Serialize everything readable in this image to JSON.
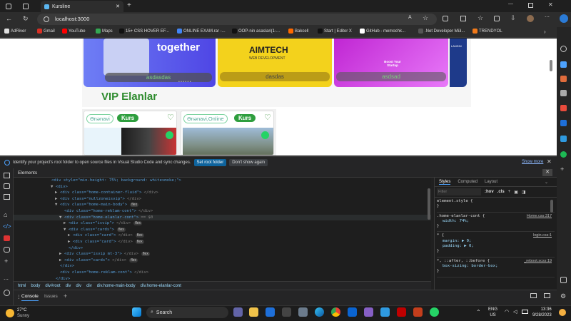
{
  "browser": {
    "tab_title": "Kursline",
    "url": "localhost:3000",
    "favorites": [
      {
        "label": "AdRiver",
        "color": "#e0e0e0"
      },
      {
        "label": "Gmail",
        "color": "#d93025"
      },
      {
        "label": "YouTube",
        "color": "#ff0000"
      },
      {
        "label": "Maps",
        "color": "#34a853"
      },
      {
        "label": "15+ CSS HOVER EF...",
        "color": "#111111"
      },
      {
        "label": "ONLINE EXAM.rar -...",
        "color": "#4285f4"
      },
      {
        "label": "OOP-nin asaslari(1-...",
        "color": "#111111"
      },
      {
        "label": "Bakcell",
        "color": "#ff6a00"
      },
      {
        "label": "Start | Editor X",
        "color": "#111111"
      },
      {
        "label": "GitHub - memochk...",
        "color": "#ffffff"
      },
      {
        "label": ".Net Developer Mül...",
        "color": "#555555"
      },
      {
        "label": "TRENDYOL",
        "color": "#f27a1a"
      }
    ]
  },
  "page": {
    "banners": [
      {
        "tag": "together",
        "caption": "asdasdas"
      },
      {
        "tag": "AIMTECH",
        "sub": "WEB DEVELOPMENT",
        "caption": "dasdas"
      },
      {
        "tag": "Boost Your Startup",
        "caption": "asdsad"
      },
      {
        "tag": "LANDIN",
        "caption": ""
      }
    ],
    "section_title": "VIP Elanlar",
    "cards": [
      {
        "name": "Ənənavi",
        "badge": "Kurs"
      },
      {
        "name": "Ənənavi,Online",
        "badge": "Kurs"
      }
    ]
  },
  "infobar": {
    "message": "Identify your project's root folder to open source files in Visual Studio Code and sync changes.",
    "primary": "Set root folder",
    "secondary": "Don't show again",
    "more": "Show more"
  },
  "devtools": {
    "panel": "Elements",
    "nodes": [
      {
        "t": "<div style=\"min-height: 75%; background: whitesmoke;\">"
      },
      {
        "t": "<div>"
      },
      {
        "t": "<div class=\"home-container-fluid\">",
        "c": "</div>"
      },
      {
        "t": "<div class=\"nullzoneisvip\">",
        "c": "</div>"
      },
      {
        "t": "<div class=\"home-main-body\">",
        "b": "flex"
      },
      {
        "t": "<div class=\"home-reklam-cont\">",
        "c": "</div>"
      },
      {
        "t": "<div class=\"home-elanlar-cont\">",
        "c": "== $0"
      },
      {
        "t": "<div class=\"isvip\">",
        "c": "</div>",
        "b": "flex"
      },
      {
        "t": "<div class=\"cards\">",
        "b": "flex"
      },
      {
        "t": "<div class=\"card\">",
        "c": "</div>",
        "b": "flex"
      },
      {
        "t": "<div class=\"card\">",
        "c": "</div>",
        "b": "flex"
      },
      {
        "t": "</div>"
      },
      {
        "t": "<div class=\"isvip mt-3\">",
        "c": "</div>",
        "b": "flex"
      },
      {
        "t": "<div class=\"cards\">",
        "c": "</div>",
        "b": "flex"
      },
      {
        "t": "</div>"
      },
      {
        "t": "<div class=\"home-reklam-cont\">",
        "c": "</div>"
      },
      {
        "t": "</div>"
      }
    ],
    "breadcrumbs": [
      "html",
      "body",
      "div#root",
      "div",
      "div",
      "div",
      "div.home-main-body",
      "div.home-elanlar-cont"
    ],
    "style_tabs": [
      "Styles",
      "Computed",
      "Layout"
    ],
    "filter_placeholder": "Filter",
    "filter_tools": [
      ":hov",
      ".cls"
    ],
    "rules": [
      {
        "sel": "element.style {",
        "props": [],
        "close": "}",
        "src": ""
      },
      {
        "sel": ".home-elanlar-cont {",
        "props": [
          "width: 74%;"
        ],
        "close": "}",
        "src": "Home.css:317"
      },
      {
        "sel": "* {",
        "props": [
          "margin: ▶ 0;",
          "padding: ▶ 0;"
        ],
        "close": "}",
        "src": "login.css:1"
      },
      {
        "sel": "*, ::after, ::before {",
        "props": [
          "box-sizing: border-box;"
        ],
        "close": "}",
        "src": "_reboot.scss:19"
      }
    ],
    "drawer_tabs": [
      "Console",
      "Issues"
    ]
  },
  "taskbar": {
    "temp": "27°C",
    "weather": "Sunny",
    "search": "Search",
    "lang": "ENG",
    "region": "US",
    "time": "13:36",
    "date": "9/28/2023"
  }
}
